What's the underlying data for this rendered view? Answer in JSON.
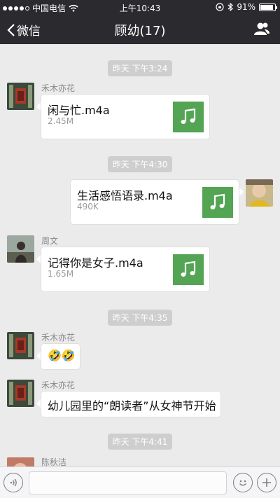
{
  "status_bar": {
    "carrier": "中国电信",
    "time": "上午10:43",
    "battery": "91%",
    "battery_level": 0.91
  },
  "nav": {
    "back_label": "微信",
    "title": "顾幼(17)"
  },
  "messages": {
    "ts1": "昨天 下午3:24",
    "ts2": "昨天 下午4:30",
    "ts3": "昨天 下午4:35",
    "ts4": "昨天 下午4:41",
    "m1": {
      "sender": "禾木亦花",
      "file_name": "闲与忙.m4a",
      "file_size": "2.45M"
    },
    "m2": {
      "file_name": "生活感悟语录.m4a",
      "file_size": "490K"
    },
    "m3": {
      "sender": "周文",
      "file_name": "记得你是女子.m4a",
      "file_size": "1.65M"
    },
    "m4": {
      "sender": "禾木亦花",
      "text": "🤣🤣"
    },
    "m5": {
      "sender": "禾木亦花",
      "text": "幼儿园里的“朗读者”从女神节开始"
    },
    "m6": {
      "sender": "陈秋洁"
    }
  },
  "icons": {
    "back": "chevron-left-icon",
    "group": "people-icon",
    "music": "music-note-icon",
    "voice": "voice-icon",
    "emoji": "emoji-icon",
    "plus": "plus-icon"
  },
  "colors": {
    "nav_bg": "#2b2b2f",
    "chat_bg": "#ebebeb",
    "music_green": "#53a453",
    "timestamp_bg": "#cecece"
  }
}
